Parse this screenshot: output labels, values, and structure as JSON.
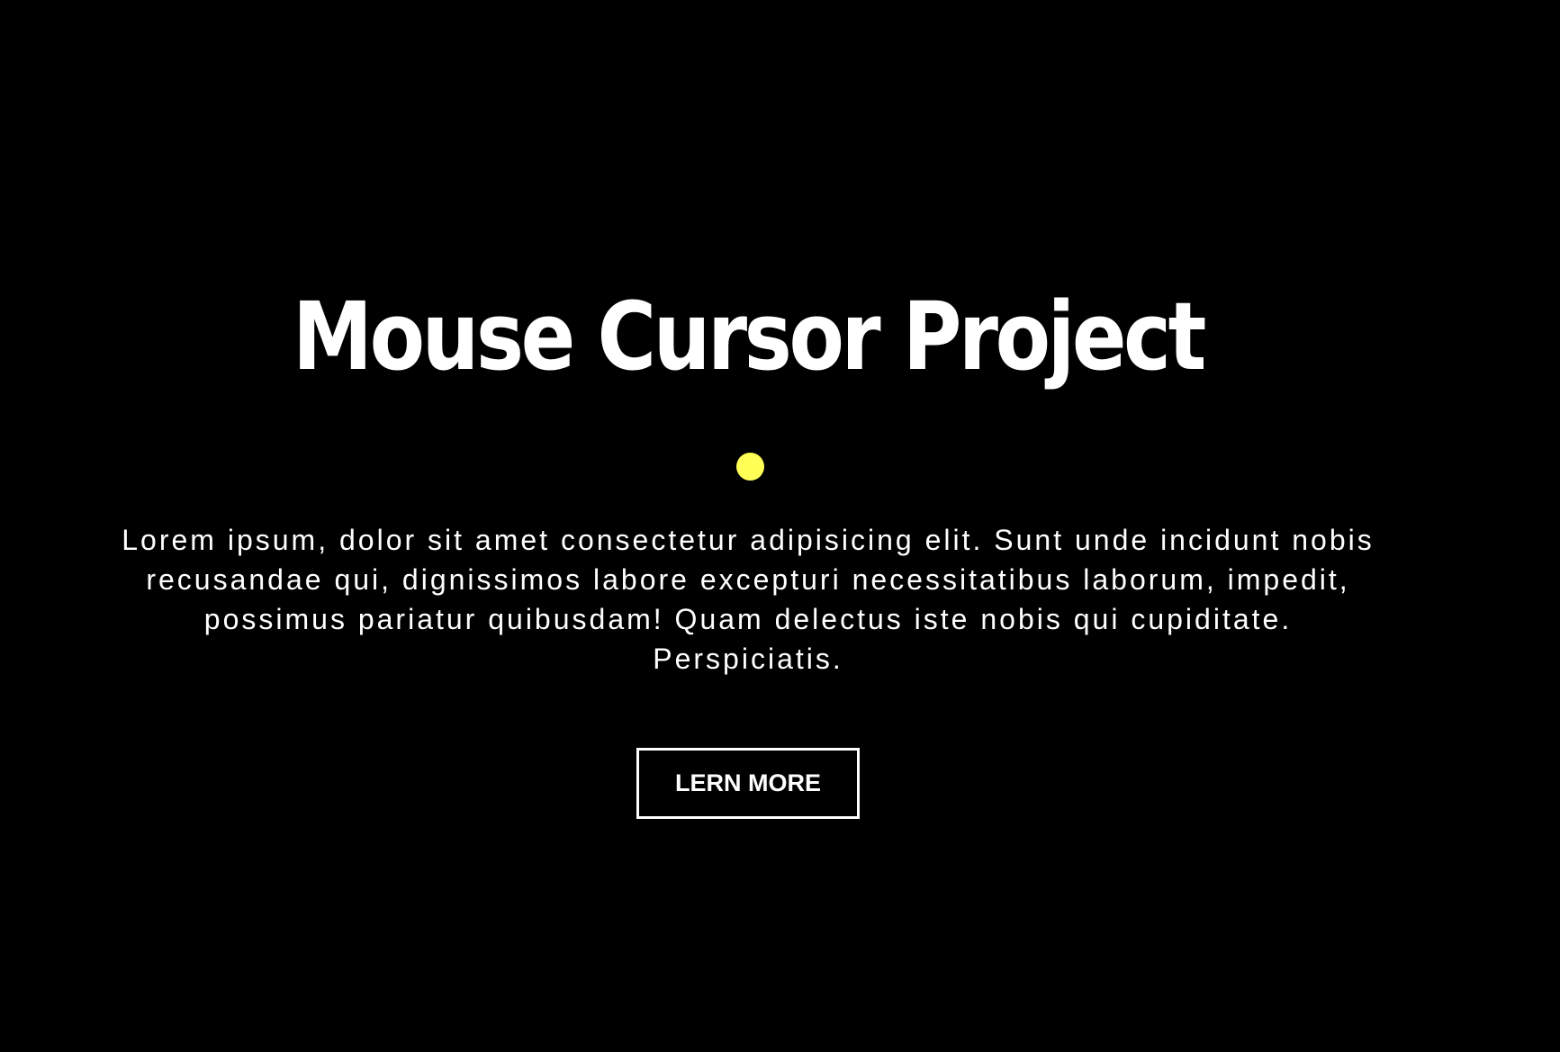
{
  "hero": {
    "title": "Mouse Cursor Project",
    "text": "Lorem ipsum, dolor sit amet consectetur adipisicing elit. Sunt unde incidunt nobis recusandae qui, dignissimos labore excepturi necessitatibus laborum, impedit, possimus pariatur quibusdam! Quam delectus iste nobis qui cupiditate. Perspiciatis.",
    "button_label": "LERN MORE"
  },
  "cursor": {
    "icon": "cursor-dot-icon",
    "color": "#ffff55"
  },
  "colors": {
    "background": "#000000",
    "text": "#ffffff"
  }
}
